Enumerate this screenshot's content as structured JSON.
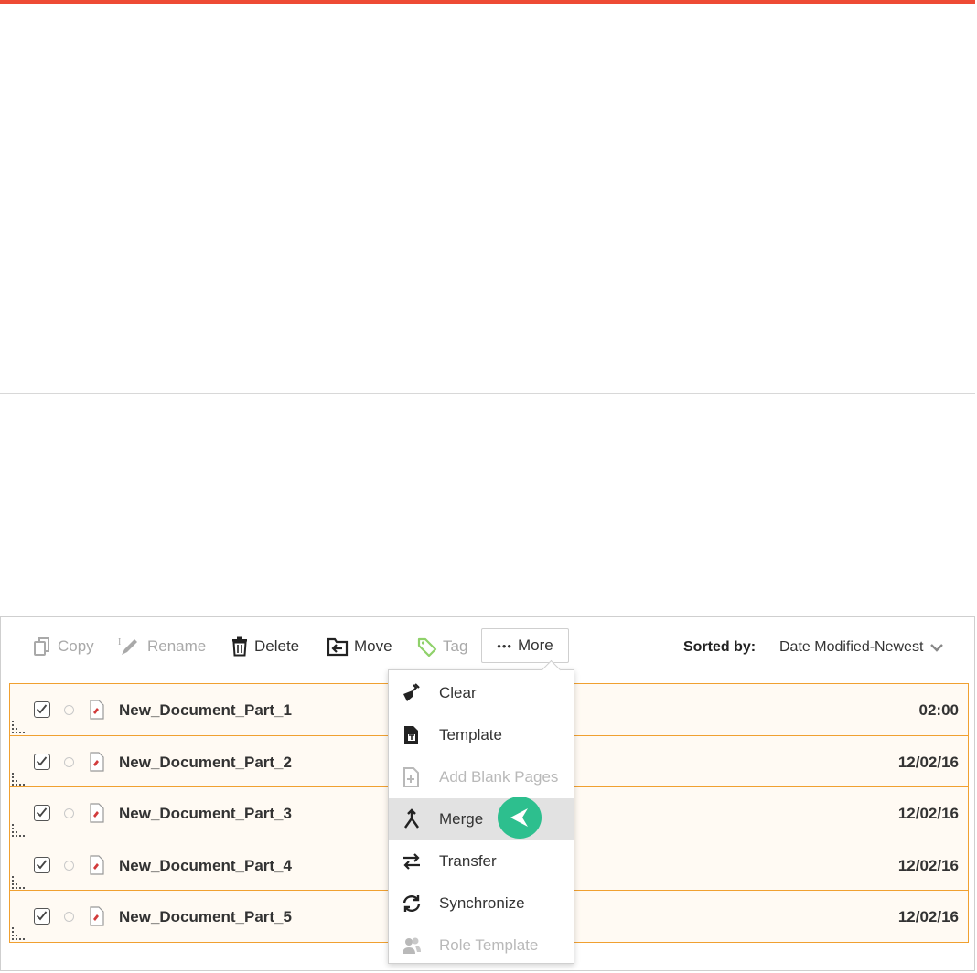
{
  "toolbar": {
    "copy_label": "Copy",
    "rename_label": "Rename",
    "delete_label": "Delete",
    "move_label": "Move",
    "tag_label": "Tag",
    "more_label": "More",
    "more_dots": "•••",
    "sorted_by_label": "Sorted by:",
    "sorted_by_value": "Date Modified-Newest"
  },
  "documents": [
    {
      "name": "New_Document_Part_1",
      "date": "02:00",
      "checked": true
    },
    {
      "name": "New_Document_Part_2",
      "date": "12/02/16",
      "checked": true
    },
    {
      "name": "New_Document_Part_3",
      "date": "12/02/16",
      "checked": true
    },
    {
      "name": "New_Document_Part_4",
      "date": "12/02/16",
      "checked": true
    },
    {
      "name": "New_Document_Part_5",
      "date": "12/02/16",
      "checked": true
    }
  ],
  "more_menu": {
    "items": [
      {
        "label": "Clear",
        "icon": "broom-icon",
        "enabled": true
      },
      {
        "label": "Template",
        "icon": "template-icon",
        "enabled": true
      },
      {
        "label": "Add Blank Pages",
        "icon": "add-page-icon",
        "enabled": false
      },
      {
        "label": "Merge",
        "icon": "merge-icon",
        "enabled": true,
        "highlighted": true
      },
      {
        "label": "Transfer",
        "icon": "transfer-icon",
        "enabled": true
      },
      {
        "label": "Synchronize",
        "icon": "sync-icon",
        "enabled": true
      },
      {
        "label": "Role Template",
        "icon": "users-icon",
        "enabled": false
      }
    ]
  },
  "colors": {
    "accent_bar": "#ee4b35",
    "row_border": "#f0a030",
    "row_background": "#fffaf3",
    "pointer": "#2dbf8e",
    "menu_highlight": "#e2e2e2"
  }
}
